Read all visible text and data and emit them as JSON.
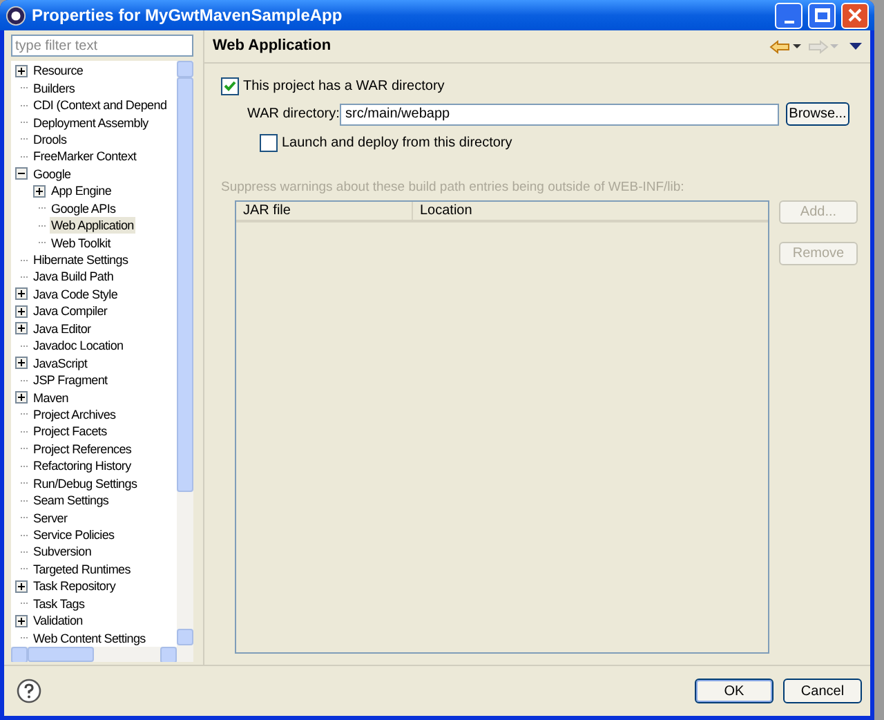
{
  "window": {
    "title": "Properties for MyGwtMavenSampleApp"
  },
  "filter": {
    "placeholder": "type filter text"
  },
  "tree": [
    {
      "label": "Resource",
      "kind": "folder",
      "expanded": false,
      "selected": false
    },
    {
      "label": "Builders",
      "kind": "leaf",
      "selected": false
    },
    {
      "label": "CDI (Context and Depend",
      "kind": "leaf",
      "selected": false
    },
    {
      "label": "Deployment Assembly",
      "kind": "leaf",
      "selected": false
    },
    {
      "label": "Drools",
      "kind": "leaf",
      "selected": false
    },
    {
      "label": "FreeMarker Context",
      "kind": "leaf",
      "selected": false
    },
    {
      "label": "Google",
      "kind": "folder",
      "expanded": true,
      "selected": false,
      "children": [
        {
          "label": "App Engine",
          "kind": "folder",
          "expanded": false,
          "selected": false
        },
        {
          "label": "Google APIs",
          "kind": "leaf",
          "selected": false
        },
        {
          "label": "Web Application",
          "kind": "leaf",
          "selected": true
        },
        {
          "label": "Web Toolkit",
          "kind": "leaf",
          "selected": false
        }
      ]
    },
    {
      "label": "Hibernate Settings",
      "kind": "leaf",
      "selected": false
    },
    {
      "label": "Java Build Path",
      "kind": "leaf",
      "selected": false
    },
    {
      "label": "Java Code Style",
      "kind": "folder",
      "expanded": false,
      "selected": false
    },
    {
      "label": "Java Compiler",
      "kind": "folder",
      "expanded": false,
      "selected": false
    },
    {
      "label": "Java Editor",
      "kind": "folder",
      "expanded": false,
      "selected": false
    },
    {
      "label": "Javadoc Location",
      "kind": "leaf",
      "selected": false
    },
    {
      "label": "JavaScript",
      "kind": "folder",
      "expanded": false,
      "selected": false
    },
    {
      "label": "JSP Fragment",
      "kind": "leaf",
      "selected": false
    },
    {
      "label": "Maven",
      "kind": "folder",
      "expanded": false,
      "selected": false
    },
    {
      "label": "Project Archives",
      "kind": "leaf",
      "selected": false
    },
    {
      "label": "Project Facets",
      "kind": "leaf",
      "selected": false
    },
    {
      "label": "Project References",
      "kind": "leaf",
      "selected": false
    },
    {
      "label": "Refactoring History",
      "kind": "leaf",
      "selected": false
    },
    {
      "label": "Run/Debug Settings",
      "kind": "leaf",
      "selected": false
    },
    {
      "label": "Seam Settings",
      "kind": "leaf",
      "selected": false
    },
    {
      "label": "Server",
      "kind": "leaf",
      "selected": false
    },
    {
      "label": "Service Policies",
      "kind": "leaf",
      "selected": false
    },
    {
      "label": "Subversion",
      "kind": "leaf",
      "selected": false
    },
    {
      "label": "Targeted Runtimes",
      "kind": "leaf",
      "selected": false
    },
    {
      "label": "Task Repository",
      "kind": "folder",
      "expanded": false,
      "selected": false
    },
    {
      "label": "Task Tags",
      "kind": "leaf",
      "selected": false
    },
    {
      "label": "Validation",
      "kind": "folder",
      "expanded": false,
      "selected": false
    },
    {
      "label": "Web Content Settings",
      "kind": "leaf",
      "selected": false
    }
  ],
  "page": {
    "title": "Web Application",
    "nav": [
      {
        "kind": "back",
        "disabled": false
      },
      {
        "kind": "forward",
        "disabled": true
      }
    ]
  },
  "war_checkbox": {
    "label": "This project has a WAR directory",
    "checked": true
  },
  "war_directory": {
    "label": "WAR directory:",
    "value": "src/main/webapp"
  },
  "browse_button": "Browse...",
  "launch_checkbox": {
    "label": "Launch and deploy from this directory",
    "checked": false
  },
  "suppress_label": {
    "text": "Suppress warnings about these build path entries being outside of WEB-INF/lib:",
    "disabled": true
  },
  "table": {
    "columns": [
      "JAR file",
      "Location"
    ]
  },
  "side_buttons": [
    {
      "label": "Add...",
      "disabled": true
    },
    {
      "label": "Remove",
      "disabled": true
    }
  ],
  "buttons": [
    "OK",
    "Cancel"
  ]
}
